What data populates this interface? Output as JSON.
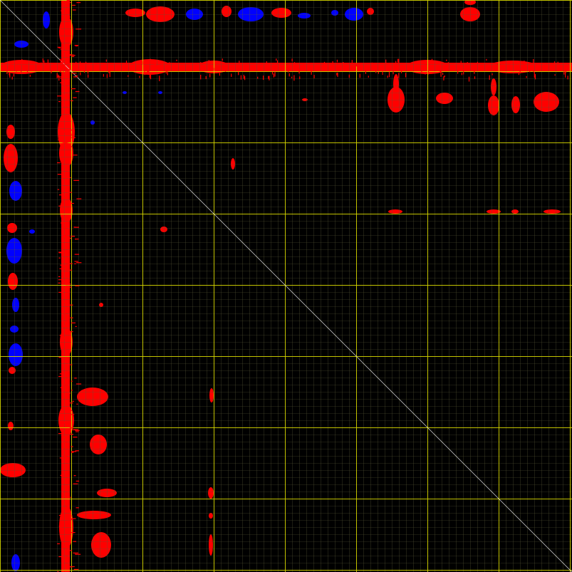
{
  "figure": {
    "background_color": "#000000",
    "minor_grid_color": "#5a5a3a",
    "major_grid_color": "#d8d800",
    "diagonal_color": "#e0e0e0",
    "positive_color": "#ff0000",
    "negative_color": "#0000ff"
  }
}
